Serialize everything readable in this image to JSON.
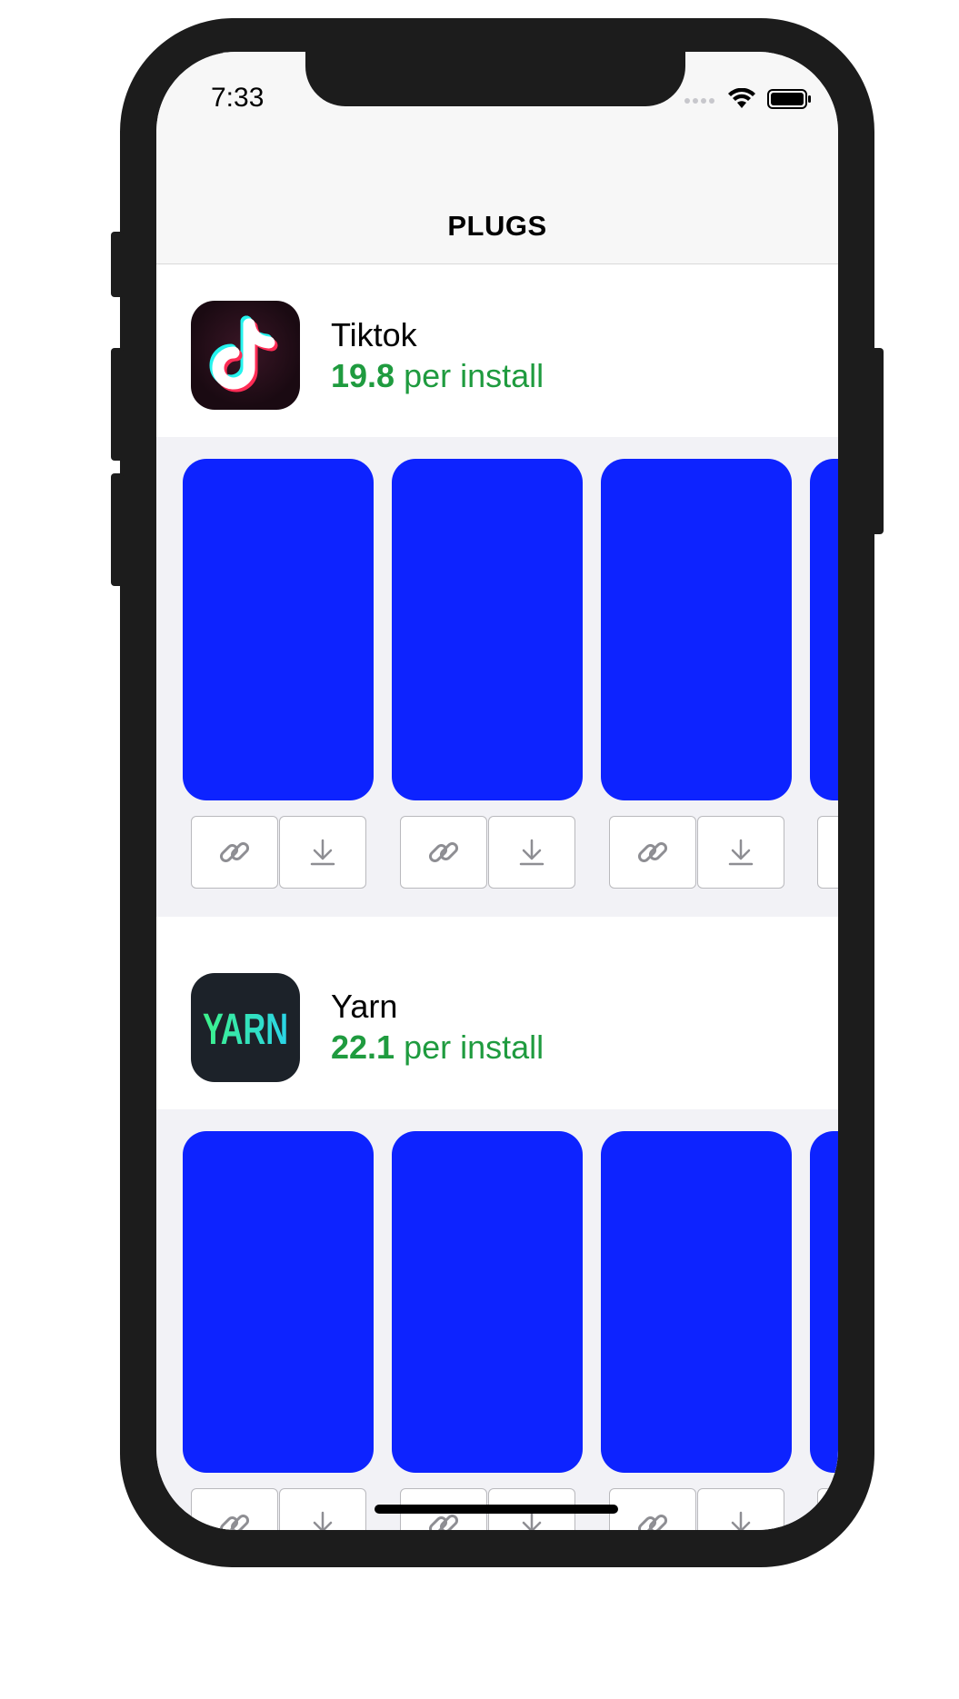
{
  "status_bar": {
    "time": "7:33"
  },
  "nav": {
    "title": "PLUGS"
  },
  "sections": [
    {
      "app_name": "Tiktok",
      "rate_value": "19.8",
      "rate_suffix": " per install",
      "icon": "tiktok-logo",
      "card_color": "#0d23ff"
    },
    {
      "app_name": "Yarn",
      "rate_value": "22.1",
      "rate_suffix": " per install",
      "icon": "yarn-logo",
      "logo_text": "YARN",
      "card_color": "#0d23ff"
    }
  ],
  "card_actions": [
    {
      "icon": "link-icon"
    },
    {
      "icon": "download-icon"
    }
  ],
  "colors": {
    "accent_green": "#1f9b3f",
    "card_blue": "#0d23ff",
    "carousel_bg": "#f2f2f6",
    "nav_bg": "#f7f7f7"
  }
}
